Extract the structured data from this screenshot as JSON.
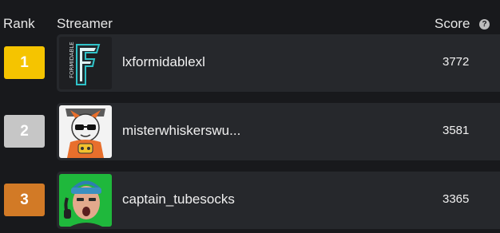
{
  "header": {
    "rank_label": "Rank",
    "streamer_label": "Streamer",
    "score_label": "Score",
    "help_icon": "question-circle-icon"
  },
  "colors": {
    "background": "#18191c",
    "card": "#26282c",
    "gold": "#f5c400",
    "silver": "#c6c6c6",
    "bronze": "#d27a26"
  },
  "leaderboard": [
    {
      "rank": "1",
      "name": "lxformidablexl",
      "score": "3772",
      "badge_color": "#f5c400",
      "avatar": "formidable-logo-avatar"
    },
    {
      "rank": "2",
      "name": "misterwhiskerswu...",
      "score": "3581",
      "badge_color": "#c6c6c6",
      "avatar": "cartoon-cat-avatar"
    },
    {
      "rank": "3",
      "name": "captain_tubesocks",
      "score": "3365",
      "badge_color": "#d27a26",
      "avatar": "streamer-photo-avatar"
    }
  ]
}
